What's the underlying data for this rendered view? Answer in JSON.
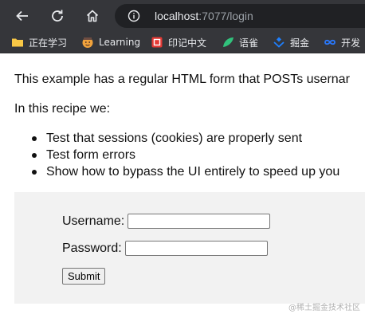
{
  "browser": {
    "nav": {
      "back_icon": "arrow-left-icon",
      "reload_icon": "reload-icon",
      "home_icon": "home-icon"
    },
    "address": {
      "host": "localhost",
      "path": ":7077/login",
      "icon": "info-icon"
    },
    "bookmarks": [
      {
        "label": "正在学习",
        "icon": "folder-icon",
        "color": "#f9c846"
      },
      {
        "label": "Learning",
        "icon": "emoji-icon",
        "color": "#f1a33c"
      },
      {
        "label": "印记中文",
        "icon": "red-logo-icon",
        "color": "#e53935"
      },
      {
        "label": "语雀",
        "icon": "green-leaf-icon",
        "color": "#31c27c"
      },
      {
        "label": "掘金",
        "icon": "blue-diamond-icon",
        "color": "#1e80ff"
      },
      {
        "label": "开发",
        "icon": "blue-infinity-icon",
        "color": "#2979ff"
      }
    ]
  },
  "page": {
    "intro": "This example has a regular HTML form that POSTs usernar",
    "recipe_intro": "In this recipe we:",
    "bullets": [
      "Test that sessions (cookies) are properly sent",
      "Test form errors",
      "Show how to bypass the UI entirely to speed up you"
    ],
    "form": {
      "username_label": "Username:",
      "password_label": "Password:",
      "username_value": "",
      "password_value": "",
      "submit_label": "Submit"
    },
    "watermark": "@稀土掘金技术社区"
  }
}
